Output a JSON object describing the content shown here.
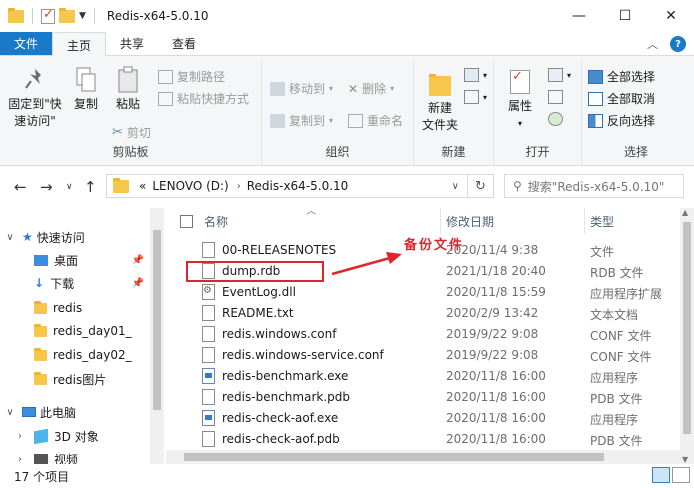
{
  "window": {
    "title": "Redis-x64-5.0.10",
    "controls": [
      "—",
      "☐",
      "✕"
    ]
  },
  "tabs": [
    "文件",
    "主页",
    "共享",
    "查看"
  ],
  "ribbon": {
    "clipboard": {
      "pin_quick": "固定到\"快速访问\"",
      "copy": "复制",
      "paste": "粘贴",
      "copy_path": "复制路径",
      "paste_shortcut": "粘贴快捷方式",
      "cut": "剪切",
      "label": "剪贴板"
    },
    "organize": {
      "move_to": "移动到",
      "copy_to": "复制到",
      "delete": "删除",
      "rename": "重命名",
      "label": "组织"
    },
    "new": {
      "new_folder": "新建\n文件夹",
      "label": "新建"
    },
    "open": {
      "properties": "属性",
      "label": "打开"
    },
    "select": {
      "select_all": "全部选择",
      "select_none": "全部取消",
      "invert": "反向选择",
      "label": "选择"
    }
  },
  "address": {
    "prefix": "«",
    "segments": [
      "LENOVO (D:)",
      "Redis-x64-5.0.10"
    ],
    "search_placeholder": "搜索\"Redis-x64-5.0.10\""
  },
  "navpane": {
    "items": [
      {
        "label": "快速访问",
        "level": 0,
        "expanded": true
      },
      {
        "label": "桌面",
        "level": 1,
        "pinned": true
      },
      {
        "label": "下载",
        "level": 1,
        "pinned": true
      },
      {
        "label": "redis",
        "level": 1
      },
      {
        "label": "redis_day01_",
        "level": 1
      },
      {
        "label": "redis_day02_",
        "level": 1
      },
      {
        "label": "redis图片",
        "level": 1
      },
      {
        "label": "此电脑",
        "level": 0,
        "expanded": true
      },
      {
        "label": "3D 对象",
        "level": 1
      },
      {
        "label": "视频",
        "level": 1
      }
    ]
  },
  "columns": {
    "name": "名称",
    "date": "修改日期",
    "type": "类型"
  },
  "files": [
    {
      "name": "00-RELEASENOTES",
      "date": "2020/11/4 9:38",
      "type": "文件",
      "icon": "file"
    },
    {
      "name": "dump.rdb",
      "date": "2021/1/18 20:40",
      "type": "RDB 文件",
      "icon": "file"
    },
    {
      "name": "EventLog.dll",
      "date": "2020/11/8 15:59",
      "type": "应用程序扩展",
      "icon": "dll"
    },
    {
      "name": "README.txt",
      "date": "2020/2/9 13:42",
      "type": "文本文档",
      "icon": "file"
    },
    {
      "name": "redis.windows.conf",
      "date": "2019/9/22 9:08",
      "type": "CONF 文件",
      "icon": "file"
    },
    {
      "name": "redis.windows-service.conf",
      "date": "2019/9/22 9:08",
      "type": "CONF 文件",
      "icon": "file"
    },
    {
      "name": "redis-benchmark.exe",
      "date": "2020/11/8 16:00",
      "type": "应用程序",
      "icon": "exe"
    },
    {
      "name": "redis-benchmark.pdb",
      "date": "2020/11/8 16:00",
      "type": "PDB 文件",
      "icon": "file"
    },
    {
      "name": "redis-check-aof.exe",
      "date": "2020/11/8 16:00",
      "type": "应用程序",
      "icon": "exe"
    },
    {
      "name": "redis-check-aof.pdb",
      "date": "2020/11/8 16:00",
      "type": "PDB 文件",
      "icon": "file"
    }
  ],
  "annotation": "备份文件",
  "status": "17 个项目",
  "colors": {
    "accent": "#1979ca",
    "annotation": "#e0252a",
    "folder": "#f6c74a"
  }
}
